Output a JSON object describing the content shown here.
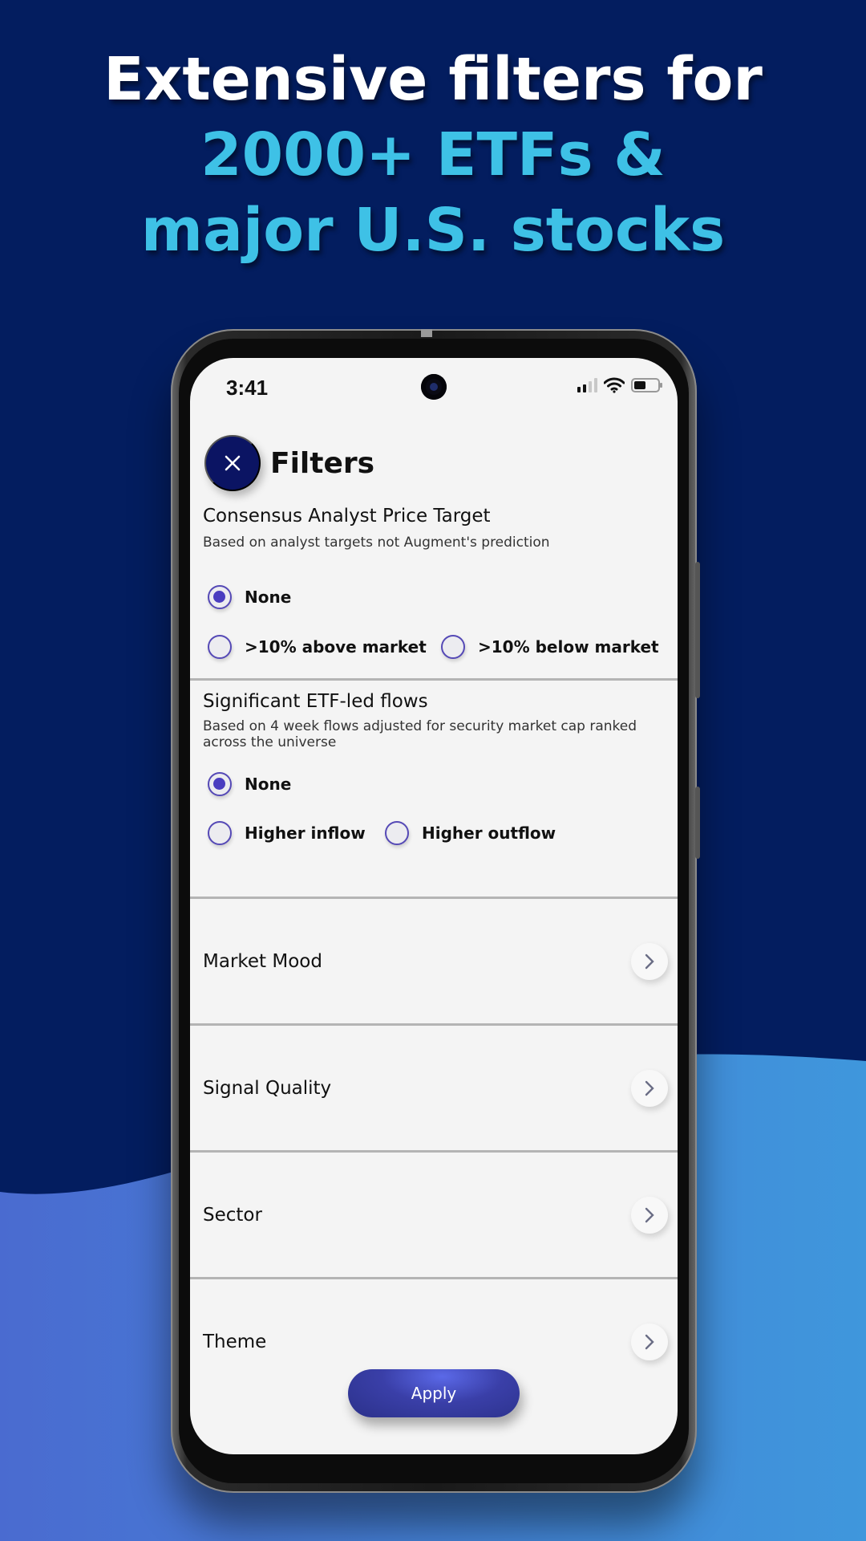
{
  "headline": {
    "line1": "Extensive filters for",
    "line2": "2000+ ETFs &",
    "line3": "major U.S. stocks"
  },
  "colors": {
    "background_dark": "#031d5f",
    "background_wave": "#4189d8",
    "headline_white": "#ffffff",
    "headline_accent": "#3ec1e6",
    "primary_button": "#3a3fa8",
    "radio_accent": "#4a3dc0",
    "close_button": "#0b1463"
  },
  "status_bar": {
    "time": "3:41",
    "icons": [
      "signal-icon",
      "wifi-icon",
      "battery-icon"
    ]
  },
  "header": {
    "close_icon": "close-icon",
    "title": "Filters"
  },
  "sections": [
    {
      "title": "Consensus Analyst Price Target",
      "subtitle": "Based on analyst targets not Augment's prediction",
      "options": [
        {
          "label": "None",
          "selected": true
        },
        {
          "label": ">10% above market",
          "selected": false
        },
        {
          "label": ">10% below market",
          "selected": false
        }
      ]
    },
    {
      "title": "Significant ETF-led flows",
      "subtitle": "Based on 4 week flows adjusted for security market cap ranked across the universe",
      "options": [
        {
          "label": "None",
          "selected": true
        },
        {
          "label": "Higher inflow",
          "selected": false
        },
        {
          "label": "Higher outflow",
          "selected": false
        }
      ]
    }
  ],
  "nav_items": [
    {
      "label": "Market Mood",
      "icon": "chevron-right-icon"
    },
    {
      "label": "Signal Quality",
      "icon": "chevron-right-icon"
    },
    {
      "label": "Sector",
      "icon": "chevron-right-icon"
    },
    {
      "label": "Theme",
      "icon": "chevron-right-icon"
    }
  ],
  "apply_label": "Apply"
}
